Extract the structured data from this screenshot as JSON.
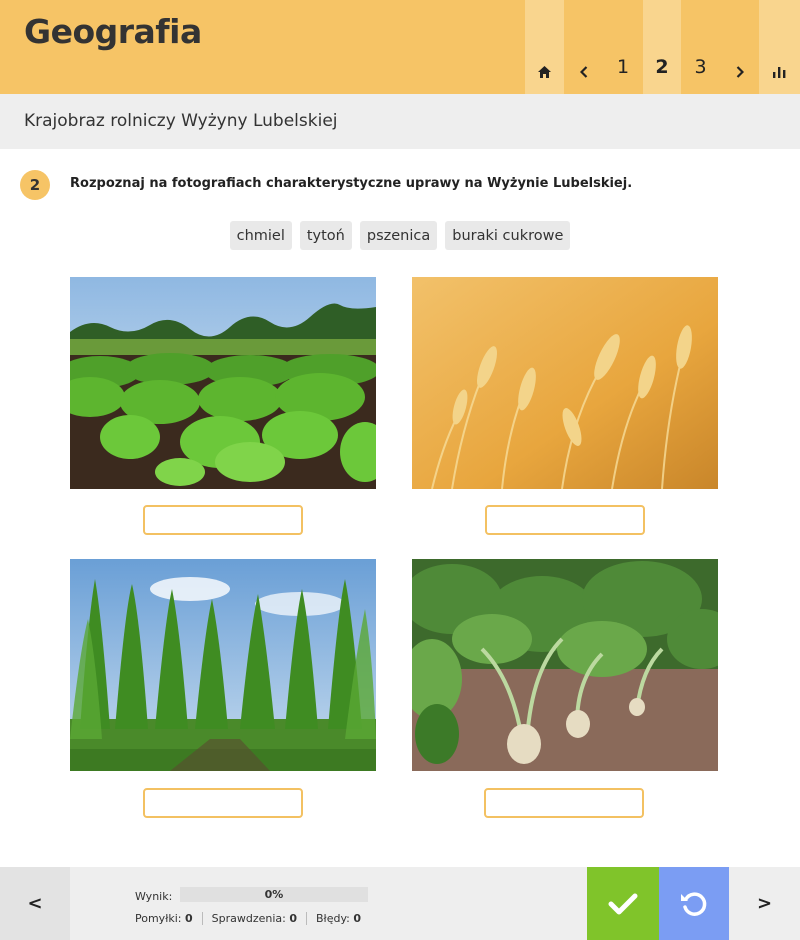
{
  "header": {
    "title": "Geografia",
    "nav": {
      "pages": [
        "1",
        "2",
        "3"
      ],
      "current_page": "2"
    }
  },
  "subheader": {
    "title": "Krajobraz rolniczy Wyżyny Lubelskiej"
  },
  "task": {
    "number": "2",
    "instruction": "Rozpoznaj na fotografiach charakterystyczne uprawy na Wyżynie Lubelskiej.",
    "options": [
      "chmiel",
      "tytoń",
      "pszenica",
      "buraki cukrowe"
    ],
    "answers": [
      "",
      "",
      "",
      ""
    ]
  },
  "footer": {
    "score_label": "Wynik:",
    "score_percent": "0%",
    "score_value": 0,
    "mistakes_label": "Pomyłki:",
    "mistakes": "0",
    "checks_label": "Sprawdzenia:",
    "checks": "0",
    "errors_label": "Błędy:",
    "errors": "0",
    "prev_label": "<",
    "next_label": ">"
  },
  "colors": {
    "accent": "#f6c466",
    "check": "#80c42a",
    "reset": "#7b9df3"
  }
}
